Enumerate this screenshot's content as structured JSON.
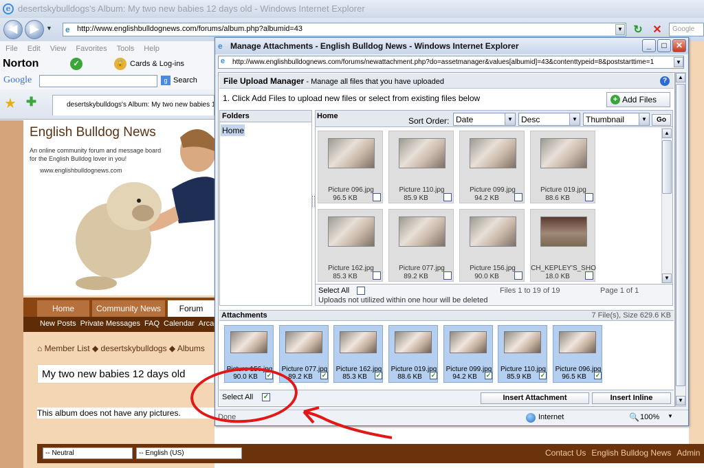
{
  "browser": {
    "window_title": "desertskybulldogs's Album: My two new babies 12 days old - Windows Internet Explorer",
    "address": "http://www.englishbulldognews.com/forums/album.php?albumid=43",
    "search_placeholder": "Google",
    "menu": [
      "File",
      "Edit",
      "View",
      "Favorites",
      "Tools",
      "Help"
    ],
    "toolbar": {
      "norton": "Norton",
      "cards": "Cards & Log-ins",
      "google_search": "Search"
    },
    "tab_title": "desertskybulldogs's Album: My two new babies 12 d..."
  },
  "site": {
    "title": "English Bulldog News",
    "tagline": "An online community forum and message board for the English Bulldog lover in you!",
    "url": "www.englishbulldognews.com",
    "nav_tabs": [
      "Home",
      "Community News",
      "Forum"
    ],
    "subnav": [
      "New Posts",
      "Private Messages",
      "FAQ",
      "Calendar",
      "Arcade"
    ],
    "breadcrumb": [
      "Member List",
      "desertskybulldogs",
      "Albums"
    ],
    "album_title": "My two new babies 12 days old",
    "no_pictures": "This album does not have any pictures.",
    "footer": {
      "style_select": "-- Neutral",
      "lang_select": "-- English (US)",
      "links": [
        "Contact Us",
        "English Bulldog News",
        "Admin"
      ]
    }
  },
  "popup": {
    "title": "Manage Attachments - English Bulldog News - Windows Internet Explorer",
    "address": "http://www.englishbulldognews.com/forums/newattachment.php?do=assetmanager&values[albumid]=43&contenttypeid=8&poststarttime=1",
    "manager_title": "File Upload Manager",
    "manager_subtitle": "- Manage all files that you have uploaded",
    "instruction": "1. Click Add Files to upload new files or select from existing files below",
    "add_files": "Add Files",
    "folders_label": "Folders",
    "folder_home": "Home",
    "files_label": "Home",
    "sort_label": "Sort Order:",
    "sort_field": "Date",
    "sort_dir": "Desc",
    "view_mode": "Thumbnail",
    "go": "Go",
    "files": [
      {
        "name": "Picture 096.jpg",
        "size": "96.5 KB"
      },
      {
        "name": "Picture 110.jpg",
        "size": "85.9 KB"
      },
      {
        "name": "Picture 099.jpg",
        "size": "94.2 KB"
      },
      {
        "name": "Picture 019.jpg",
        "size": "88.6 KB"
      },
      {
        "name": "Picture 162.jpg",
        "size": "85.3 KB"
      },
      {
        "name": "Picture 077.jpg",
        "size": "89.2 KB"
      },
      {
        "name": "Picture 156.jpg",
        "size": "90.0 KB"
      },
      {
        "name": "CH_KEPLEY'S_SHO",
        "size": "18.0 KB"
      }
    ],
    "select_all": "Select All",
    "files_count": "Files 1 to 19 of 19",
    "page_info": "Page 1 of 1",
    "upload_note": "Uploads not utilized within one hour will be deleted",
    "attachments_label": "Attachments",
    "attachments_summary": "7 File(s), Size 629.6 KB",
    "attachments": [
      {
        "name": "Picture 156.jpg",
        "size": "90.0 KB"
      },
      {
        "name": "Picture 077.jpg",
        "size": "89.2 KB"
      },
      {
        "name": "Picture 162.jpg",
        "size": "85.3 KB"
      },
      {
        "name": "Picture 019.jpg",
        "size": "88.6 KB"
      },
      {
        "name": "Picture 099.jpg",
        "size": "94.2 KB"
      },
      {
        "name": "Picture 110.jpg",
        "size": "85.9 KB"
      },
      {
        "name": "Picture 096.jpg",
        "size": "96.5 KB"
      }
    ],
    "att_select_all": "Select All",
    "insert_attachment": "Insert Attachment",
    "insert_inline": "Insert Inline",
    "status_done": "Done",
    "status_zone": "Internet",
    "zoom": "100%"
  }
}
